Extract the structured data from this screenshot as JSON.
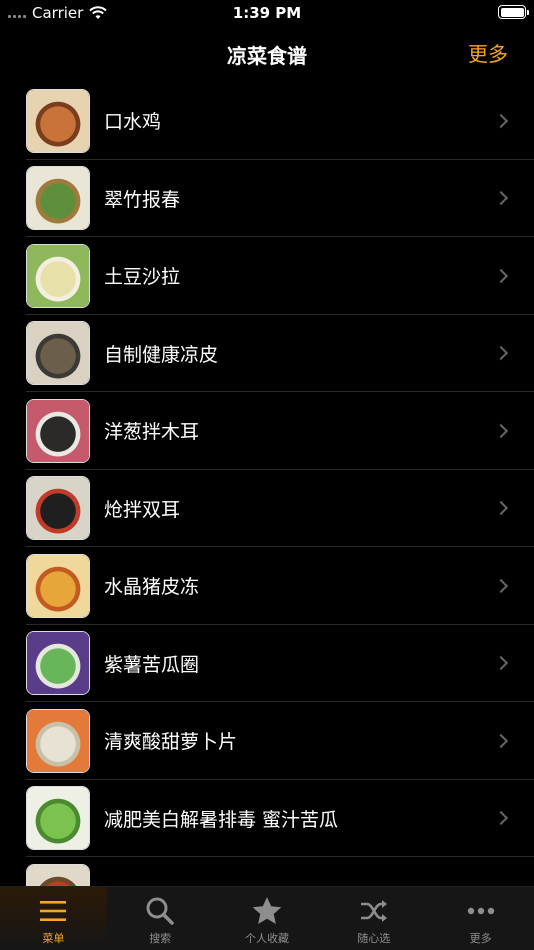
{
  "status_bar": {
    "carrier": "Carrier",
    "time": "1:39 PM"
  },
  "nav": {
    "title": "凉菜食谱",
    "more": "更多",
    "accent": "#f5a623"
  },
  "recipes": [
    {
      "label": "口水鸡",
      "palette": [
        "#c9733a",
        "#e8d3b0",
        "#7a3d1d"
      ]
    },
    {
      "label": "翠竹报春",
      "palette": [
        "#5e8f3c",
        "#e9e6d8",
        "#a07a3c"
      ]
    },
    {
      "label": "土豆沙拉",
      "palette": [
        "#e7e0a8",
        "#8fb85c",
        "#f2efe0"
      ]
    },
    {
      "label": "自制健康凉皮",
      "palette": [
        "#6b5e4a",
        "#d9d2c2",
        "#3b3a36"
      ]
    },
    {
      "label": "洋葱拌木耳",
      "palette": [
        "#2c2a28",
        "#c45a6b",
        "#e9e9e4"
      ]
    },
    {
      "label": "炝拌双耳",
      "palette": [
        "#1f1f1f",
        "#d8d4c8",
        "#c23a2a"
      ]
    },
    {
      "label": "水晶猪皮冻",
      "palette": [
        "#e6a63a",
        "#f0d79a",
        "#c25a22"
      ]
    },
    {
      "label": "紫薯苦瓜圈",
      "palette": [
        "#69b55a",
        "#5a3d8a",
        "#e4e8dc"
      ]
    },
    {
      "label": "清爽酸甜萝卜片",
      "palette": [
        "#e8e2d4",
        "#e47a3a",
        "#c8c0a8"
      ]
    },
    {
      "label": "减肥美白解暑排毒 蜜汁苦瓜",
      "palette": [
        "#7cc24e",
        "#eef0e6",
        "#4a8a30"
      ]
    },
    {
      "label": "",
      "palette": [
        "#c23a22",
        "#e0d8c8",
        "#6a4a2a"
      ]
    }
  ],
  "tabs": [
    {
      "label": "菜单",
      "icon": "menu-icon",
      "active": true
    },
    {
      "label": "搜索",
      "icon": "search-icon",
      "active": false
    },
    {
      "label": "个人收藏",
      "icon": "star-icon",
      "active": false
    },
    {
      "label": "随心选",
      "icon": "shuffle-icon",
      "active": false
    },
    {
      "label": "更多",
      "icon": "more-dots-icon",
      "active": false
    }
  ]
}
